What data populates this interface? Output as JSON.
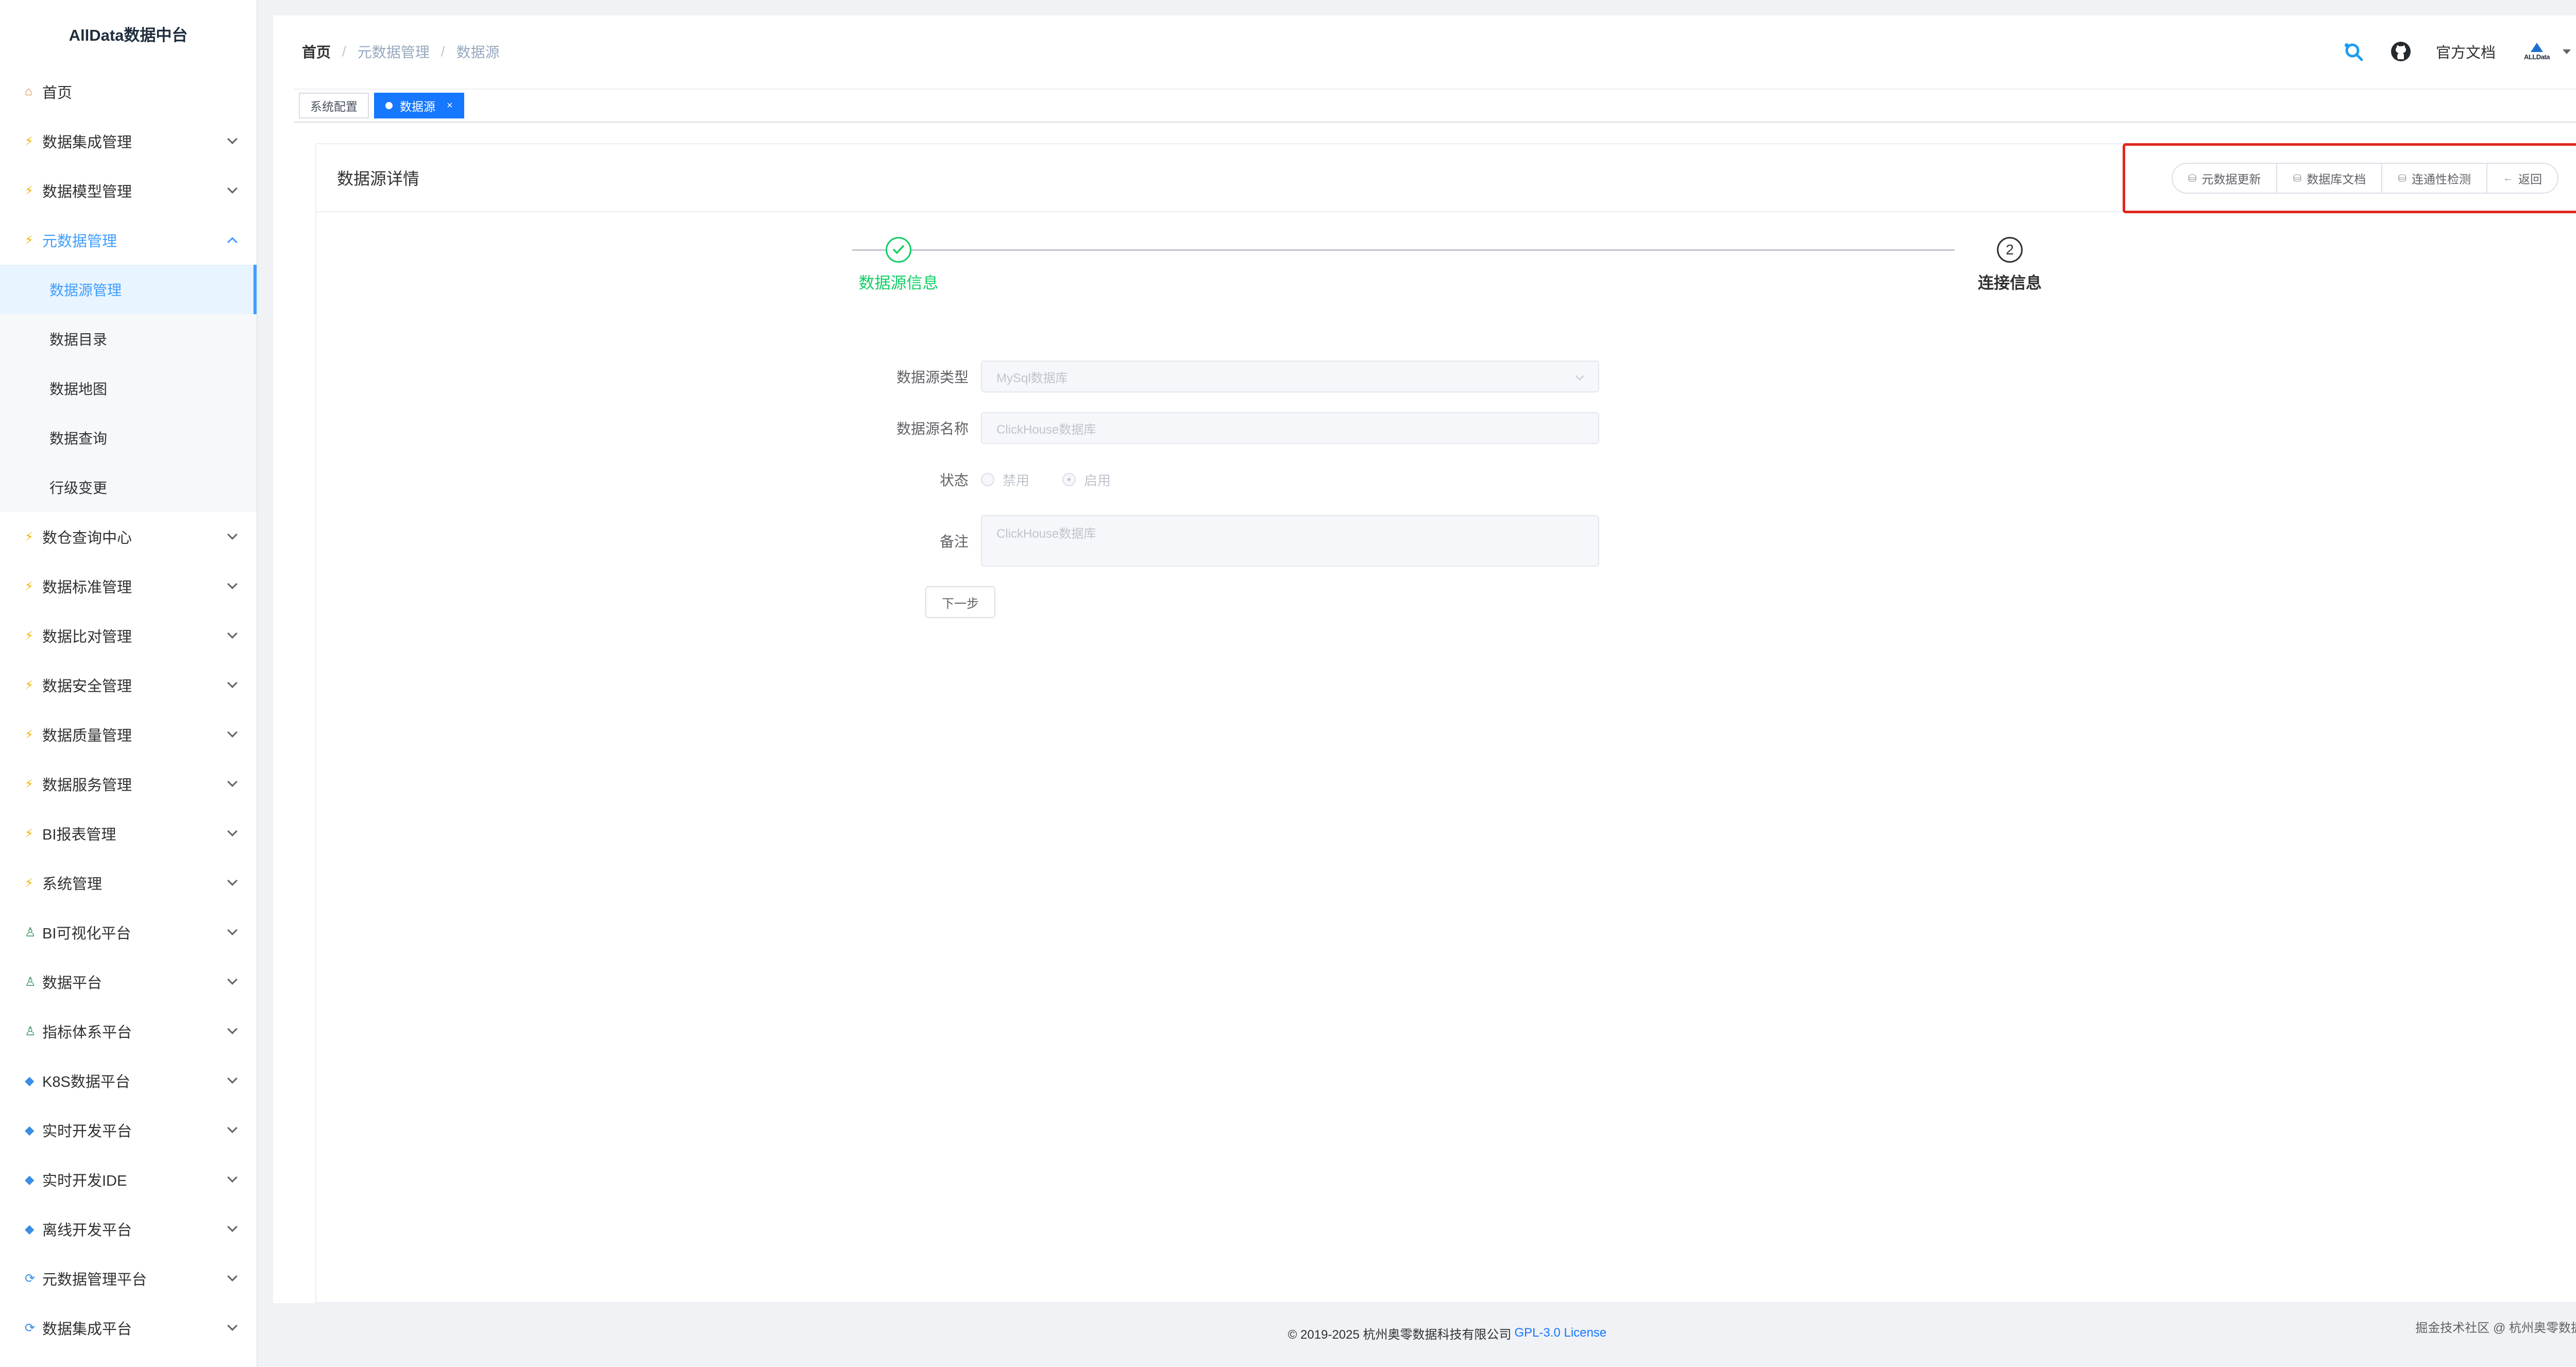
{
  "app": {
    "title": "AllData数据中台"
  },
  "sidebar": {
    "home": "首页",
    "items": [
      {
        "label": "数据集成管理"
      },
      {
        "label": "数据模型管理"
      },
      {
        "label": "元数据管理",
        "sub": [
          {
            "label": "数据源管理"
          },
          {
            "label": "数据目录"
          },
          {
            "label": "数据地图"
          },
          {
            "label": "数据查询"
          },
          {
            "label": "行级变更"
          }
        ]
      },
      {
        "label": "数仓查询中心"
      },
      {
        "label": "数据标准管理"
      },
      {
        "label": "数据比对管理"
      },
      {
        "label": "数据安全管理"
      },
      {
        "label": "数据质量管理"
      },
      {
        "label": "数据服务管理"
      },
      {
        "label": "BI报表管理"
      },
      {
        "label": "系统管理"
      },
      {
        "label": "BI可视化平台"
      },
      {
        "label": "数据平台"
      },
      {
        "label": "指标体系平台"
      },
      {
        "label": "K8S数据平台"
      },
      {
        "label": "实时开发平台"
      },
      {
        "label": "实时开发IDE"
      },
      {
        "label": "离线开发平台"
      },
      {
        "label": "元数据管理平台"
      },
      {
        "label": "数据集成平台"
      }
    ]
  },
  "breadcrumb": [
    "首页",
    "元数据管理",
    "数据源"
  ],
  "navbar": {
    "doc_link": "官方文档",
    "user_logo_text": "ALLData"
  },
  "tags": [
    {
      "label": "系统配置"
    },
    {
      "label": "数据源",
      "close": "×"
    }
  ],
  "card": {
    "title": "数据源详情",
    "buttons": [
      "元数据更新",
      "数据库文档",
      "连通性检测",
      "返回"
    ]
  },
  "steps": [
    {
      "title": "数据源信息",
      "status": "done"
    },
    {
      "title": "连接信息",
      "number": "2",
      "status": "current"
    }
  ],
  "form": {
    "type_label": "数据源类型",
    "type_value": "MySql数据库",
    "name_label": "数据源名称",
    "name_value": "ClickHouse数据库",
    "status_label": "状态",
    "status_options": [
      "禁用",
      "启用"
    ],
    "status_selected": "启用",
    "remark_label": "备注",
    "remark_value": "ClickHouse数据库",
    "next_button": "下一步"
  },
  "footer": {
    "copyright": "© 2019-2025 杭州奥零数据科技有限公司",
    "license": "GPL-3.0 License",
    "right_text": "掘金技术社区 @ 杭州奥零数据科技"
  },
  "colors": {
    "primary": "#1677ff",
    "success": "#13ce66",
    "highlight": "#e0281e",
    "accent_icon": "#f0b400"
  }
}
